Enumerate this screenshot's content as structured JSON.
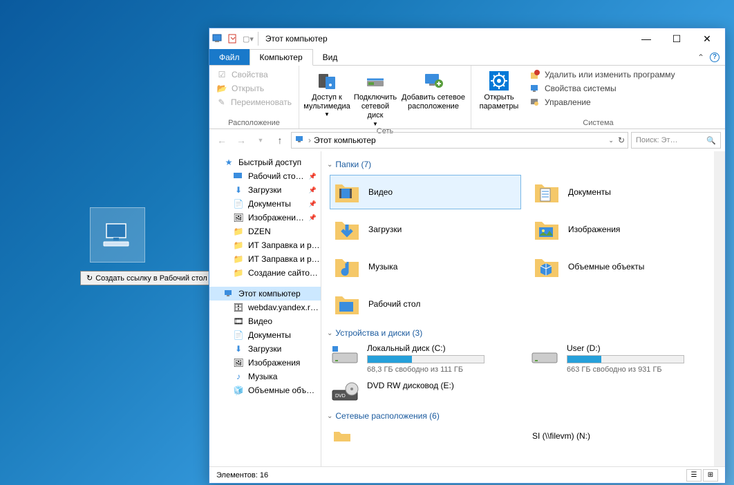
{
  "desktop": {
    "drag_tooltip": "Создать ссылку в Рабочий стол"
  },
  "titlebar": {
    "title": "Этот компьютер"
  },
  "tabs": {
    "file": "Файл",
    "computer": "Компьютер",
    "view": "Вид"
  },
  "ribbon": {
    "location": {
      "properties": "Свойства",
      "open": "Открыть",
      "rename": "Переименовать",
      "group_label": "Расположение"
    },
    "network": {
      "media_access_l1": "Доступ к",
      "media_access_l2": "мультимедиа",
      "map_l1": "Подключить",
      "map_l2": "сетевой диск",
      "add_l1": "Добавить сетевое",
      "add_l2": "расположение",
      "group_label": "Сеть"
    },
    "system": {
      "settings_l1": "Открыть",
      "settings_l2": "параметры",
      "uninstall": "Удалить или изменить программу",
      "sysprops": "Свойства системы",
      "manage": "Управление",
      "group_label": "Система"
    }
  },
  "nav": {
    "breadcrumb_root": "Этот компьютер",
    "search_placeholder": "Поиск: Эт…"
  },
  "navpane": {
    "quick_access": "Быстрый доступ",
    "desktop": "Рабочий сто…",
    "downloads": "Загрузки",
    "documents": "Документы",
    "pictures": "Изображени…",
    "dzen": "DZEN",
    "it1": "ИТ Заправка и р…",
    "it2": "ИТ Заправка и р…",
    "sites": "Создание сайто…",
    "this_pc": "Этот компьютер",
    "webdav": "webdav.yandex.r…",
    "video": "Видео",
    "documents2": "Документы",
    "downloads2": "Загрузки",
    "pictures2": "Изображения",
    "music": "Музыка",
    "objects3d": "Объемные объ…"
  },
  "groups": {
    "folders": "Папки (7)",
    "drives": "Устройства и диски (3)",
    "netloc": "Сетевые расположения (6)"
  },
  "folders": {
    "video": "Видео",
    "documents": "Документы",
    "downloads": "Загрузки",
    "pictures": "Изображения",
    "music": "Музыка",
    "objects3d": "Объемные объекты",
    "desktop": "Рабочий стол"
  },
  "drives": {
    "c": {
      "name": "Локальный диск (C:)",
      "sub": "68,3 ГБ свободно из 111 ГБ",
      "pct": 38
    },
    "d": {
      "name": "User (D:)",
      "sub": "663 ГБ свободно из 931 ГБ",
      "pct": 29
    },
    "dvd": {
      "name": "DVD RW дисковод (E:)"
    }
  },
  "netloc": {
    "item2": "SI (\\\\filevm) (N:)"
  },
  "statusbar": {
    "count": "Элементов: 16"
  }
}
